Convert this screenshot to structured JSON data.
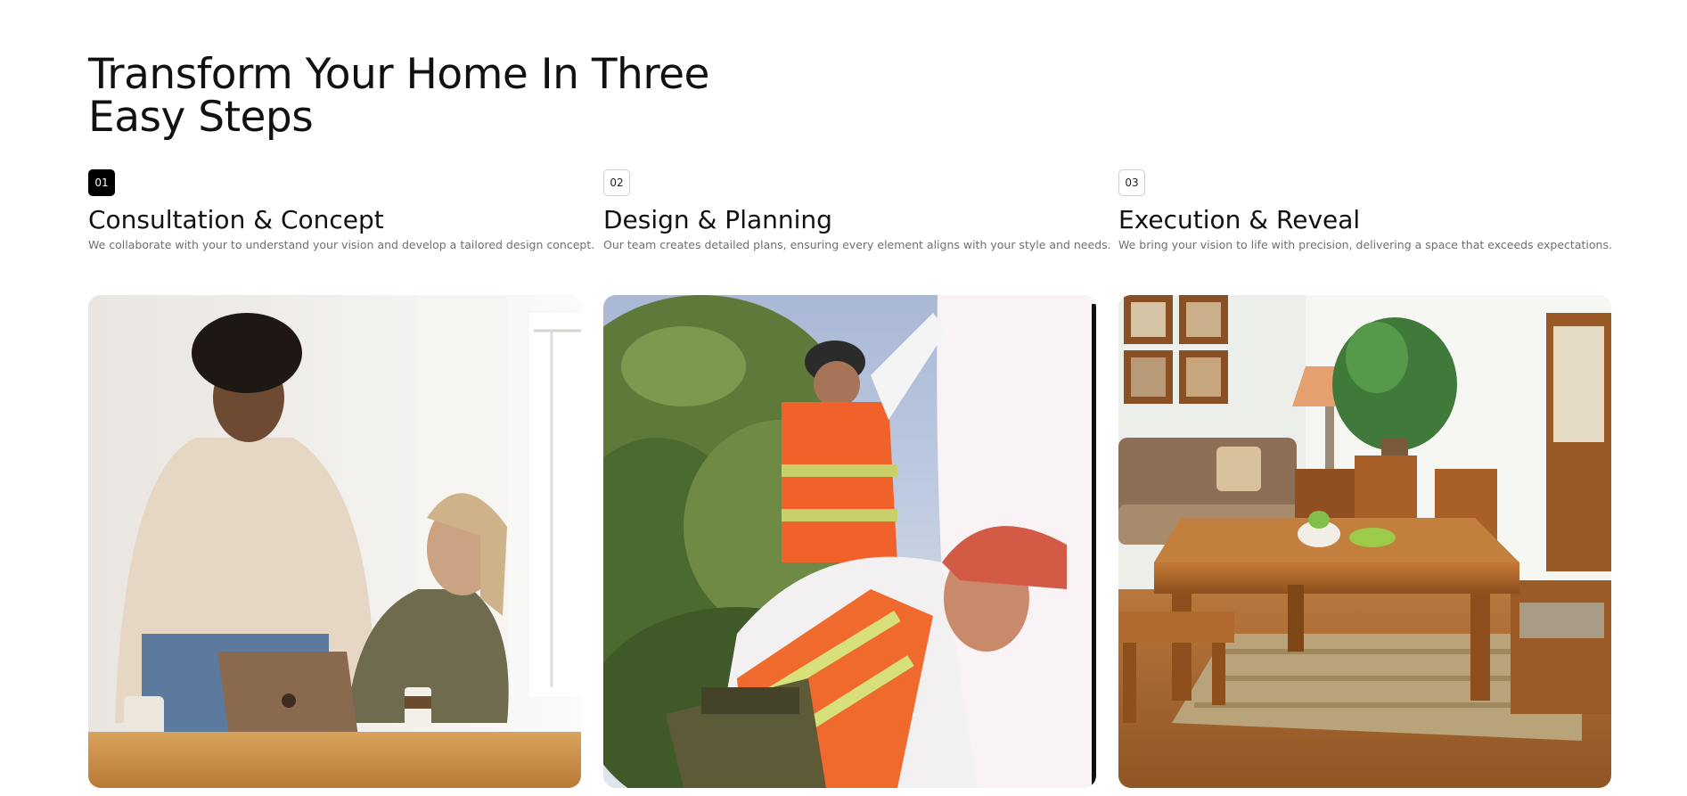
{
  "section": {
    "title": "Transform Your Home In Three Easy Steps"
  },
  "steps": [
    {
      "number": "01",
      "title": "Consultation & Concept",
      "description": "We collaborate with your to understand your vision and develop a tailored design concept.",
      "active": true
    },
    {
      "number": "02",
      "title": "Design & Planning",
      "description": "Our team creates detailed plans, ensuring every element aligns with your style and needs.",
      "active": false
    },
    {
      "number": "03",
      "title": "Execution & Reveal",
      "description": "We bring your vision to life with precision, delivering a space that exceeds expectations.",
      "active": false
    }
  ],
  "images": [
    {
      "subject": "two women with laptop and coffee at wooden table"
    },
    {
      "subject": "construction workers in orange safety vests and hard hats"
    },
    {
      "subject": "furnished living room with wooden table, chairs and sofa"
    }
  ]
}
